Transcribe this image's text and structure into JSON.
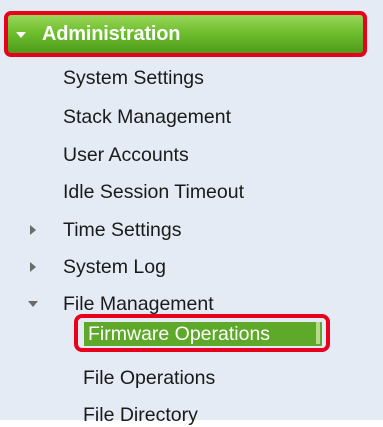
{
  "header": {
    "label": "Administration"
  },
  "nav": {
    "items": [
      {
        "label": "System Settings"
      },
      {
        "label": "Stack Management"
      },
      {
        "label": "User Accounts"
      },
      {
        "label": "Idle Session Timeout"
      },
      {
        "label": "Time Settings"
      },
      {
        "label": "System Log"
      },
      {
        "label": "File Management"
      }
    ],
    "sub_items": [
      {
        "label": "Firmware Operations"
      },
      {
        "label": "File Operations"
      },
      {
        "label": "File Directory"
      }
    ]
  },
  "icons": {
    "header_toggle": "chevron-down-icon",
    "collapsed": "triangle-right-icon",
    "expanded": "triangle-down-icon"
  },
  "colors": {
    "header_green": "#6fbf2e",
    "highlight_border": "#e8001c",
    "selected_fill": "#5ea82a",
    "panel_bg": "#e4ebf4"
  }
}
